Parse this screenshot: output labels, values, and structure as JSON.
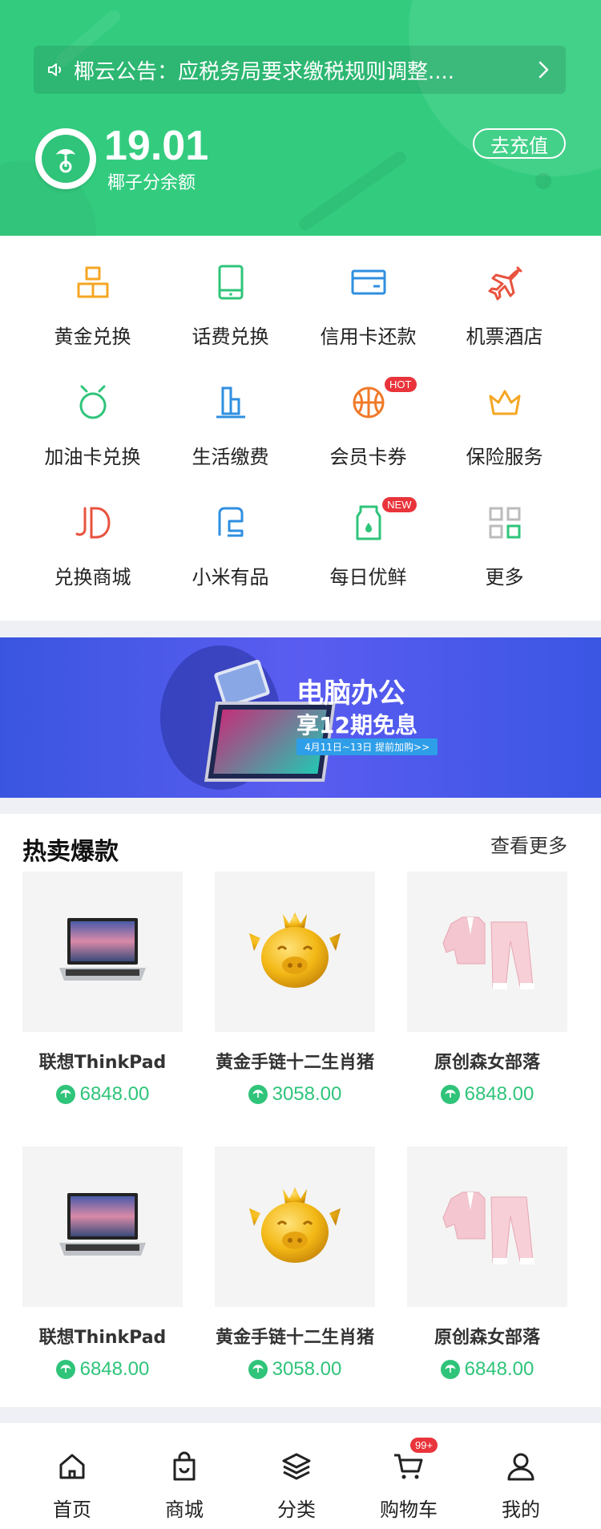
{
  "header": {
    "notice_text": "椰云公告：应税务局要求缴税规则调整....",
    "balance": "19.01",
    "balance_label": "椰子分余额",
    "recharge_label": "去充值",
    "color": "#33cc7f"
  },
  "services": [
    {
      "label": "黄金兑换",
      "icon": "gold-bars-icon",
      "color": "#f5a623"
    },
    {
      "label": "话费兑换",
      "icon": "phone-icon",
      "color": "#2fc47a"
    },
    {
      "label": "信用卡还款",
      "icon": "credit-card-icon",
      "color": "#2f8fe0"
    },
    {
      "label": "机票酒店",
      "icon": "airplane-icon",
      "color": "#e8533f"
    },
    {
      "label": "加油卡兑换",
      "icon": "fuel-icon",
      "color": "#2fc47a"
    },
    {
      "label": "生活缴费",
      "icon": "building-icon",
      "color": "#2f8fe0"
    },
    {
      "label": "会员卡券",
      "icon": "basketball-icon",
      "color": "#f07a2a",
      "badge": "HOT"
    },
    {
      "label": "保险服务",
      "icon": "crown-icon",
      "color": "#f5a623"
    },
    {
      "label": "兑换商城",
      "icon": "jd-icon",
      "color": "#e8533f"
    },
    {
      "label": "小米有品",
      "icon": "youpin-icon",
      "color": "#2f8fe0"
    },
    {
      "label": "每日优鲜",
      "icon": "milk-icon",
      "color": "#2fc47a",
      "badge": "NEW"
    },
    {
      "label": "更多",
      "icon": "grid-more-icon",
      "color": "#bbbbbb"
    }
  ],
  "banner": {
    "title": "电脑办公",
    "subtitle": "享12期免息",
    "tag": "4月11日~13日 提前加购>>"
  },
  "hot": {
    "title": "热卖爆款",
    "more": "查看更多",
    "products": [
      {
        "name": "联想ThinkPad",
        "price": "6848.00",
        "kind": "laptop"
      },
      {
        "name": "黄金手链十二生肖猪",
        "price": "3058.00",
        "kind": "gold-pig"
      },
      {
        "name": "原创森女部落",
        "price": "6848.00",
        "kind": "pajamas"
      },
      {
        "name": "联想ThinkPad",
        "price": "6848.00",
        "kind": "laptop"
      },
      {
        "name": "黄金手链十二生肖猪",
        "price": "3058.00",
        "kind": "gold-pig"
      },
      {
        "name": "原创森女部落",
        "price": "6848.00",
        "kind": "pajamas"
      }
    ]
  },
  "tabbar": [
    {
      "label": "首页",
      "icon": "home-icon"
    },
    {
      "label": "商城",
      "icon": "shopping-bag-icon"
    },
    {
      "label": "分类",
      "icon": "layers-icon"
    },
    {
      "label": "购物车",
      "icon": "cart-icon",
      "badge": "99+"
    },
    {
      "label": "我的",
      "icon": "user-icon"
    }
  ]
}
